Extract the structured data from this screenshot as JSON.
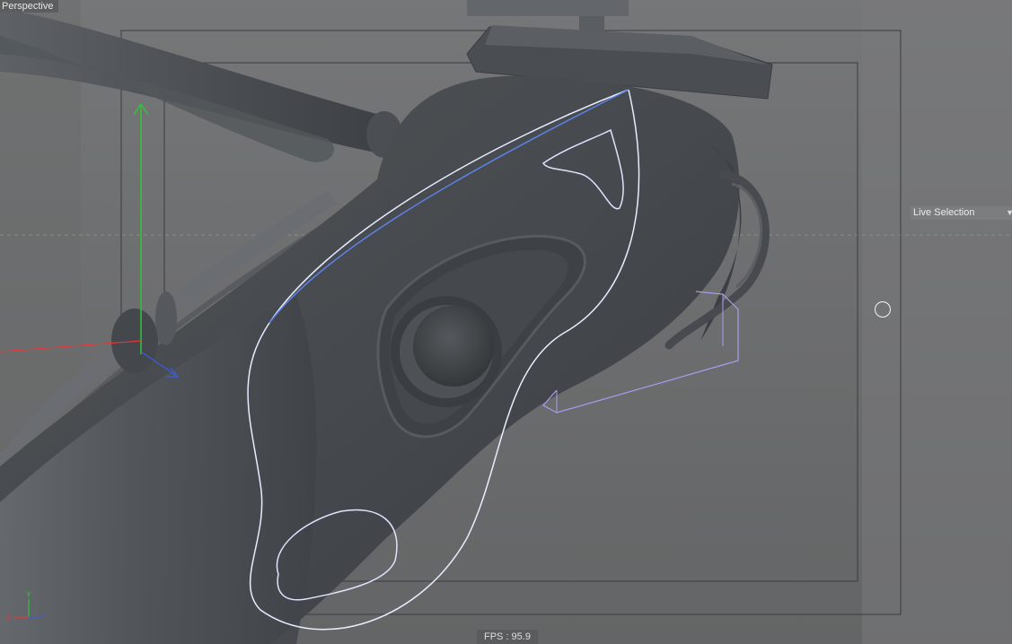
{
  "viewport": {
    "view_name": "Perspective",
    "fps_label": "FPS : 95.9",
    "hud": {
      "live_selection_label": "Live Selection",
      "dropdown_icon": "chevron-down-icon"
    },
    "axis_gizmo": {
      "x_label": "X",
      "y_label": "Y",
      "z_label": "Z"
    },
    "colors": {
      "background": "#6e6f70",
      "spline": "#e8ecff",
      "spline_selected": "#5c82e6",
      "bounding_box": "#a79cf0",
      "axis_x": "#e03a3a",
      "axis_y": "#35c23a",
      "axis_z": "#3a5ce0"
    }
  }
}
